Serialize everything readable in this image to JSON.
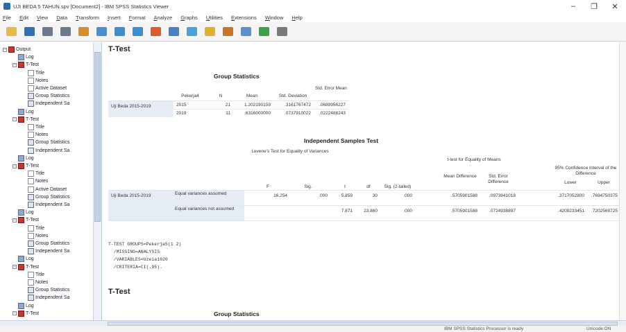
{
  "window": {
    "title": "UJI BEDA 5 TAHUN.spv [Document2] - IBM SPSS Statistics Viewer",
    "minimize": "–",
    "maximize": "❐",
    "close": "✕"
  },
  "menu": [
    "File",
    "Edit",
    "View",
    "Data",
    "Transform",
    "Insert",
    "Format",
    "Analyze",
    "Graphs",
    "Utilities",
    "Extensions",
    "Window",
    "Help"
  ],
  "toolbar_icons": [
    "open-icon",
    "save-icon",
    "print-icon",
    "print-preview-icon",
    "export-icon",
    "goto-data-icon",
    "undo-icon",
    "redo-icon",
    "goto-case-icon",
    "goto-variable-icon",
    "variables-icon",
    "insert-output-icon",
    "designate-window-icon",
    "spelling-icon",
    "show-all-icon",
    "collapse-icon"
  ],
  "nav": {
    "items": [
      {
        "label": "Output",
        "icon": "book",
        "level": 0
      },
      {
        "label": "Log",
        "icon": "log",
        "level": 1
      },
      {
        "label": "T-Test",
        "icon": "book",
        "level": 1
      },
      {
        "label": "Title",
        "icon": "page",
        "level": 2
      },
      {
        "label": "Notes",
        "icon": "page",
        "level": 2
      },
      {
        "label": "Active Dataset",
        "icon": "page",
        "level": 2
      },
      {
        "label": "Group Statistics",
        "icon": "tbl",
        "level": 2
      },
      {
        "label": "Independent Sa",
        "icon": "tbl",
        "level": 2
      },
      {
        "label": "Log",
        "icon": "log",
        "level": 1
      },
      {
        "label": "T-Test",
        "icon": "book",
        "level": 1
      },
      {
        "label": "Title",
        "icon": "page",
        "level": 2
      },
      {
        "label": "Notes",
        "icon": "page",
        "level": 2
      },
      {
        "label": "Group Statistics",
        "icon": "tbl",
        "level": 2
      },
      {
        "label": "Independent Sa",
        "icon": "tbl",
        "level": 2
      },
      {
        "label": "Log",
        "icon": "log",
        "level": 1
      },
      {
        "label": "T-Test",
        "icon": "book",
        "level": 1
      },
      {
        "label": "Title",
        "icon": "page",
        "level": 2
      },
      {
        "label": "Notes",
        "icon": "page",
        "level": 2
      },
      {
        "label": "Active Dataset",
        "icon": "page",
        "level": 2
      },
      {
        "label": "Group Statistics",
        "icon": "tbl",
        "level": 2
      },
      {
        "label": "Independent Sa",
        "icon": "tbl",
        "level": 2
      },
      {
        "label": "Log",
        "icon": "log",
        "level": 1
      },
      {
        "label": "T-Test",
        "icon": "book",
        "level": 1
      },
      {
        "label": "Title",
        "icon": "page",
        "level": 2
      },
      {
        "label": "Notes",
        "icon": "page",
        "level": 2
      },
      {
        "label": "Group Statistics",
        "icon": "tbl",
        "level": 2
      },
      {
        "label": "Independent Sa",
        "icon": "tbl",
        "level": 2
      },
      {
        "label": "Log",
        "icon": "log",
        "level": 1
      },
      {
        "label": "T-Test",
        "icon": "book",
        "level": 1
      },
      {
        "label": "Title",
        "icon": "page",
        "level": 2
      },
      {
        "label": "Notes",
        "icon": "page",
        "level": 2
      },
      {
        "label": "Group Statistics",
        "icon": "tbl",
        "level": 2
      },
      {
        "label": "Independent Sa",
        "icon": "tbl",
        "level": 2
      },
      {
        "label": "Log",
        "icon": "log",
        "level": 1
      },
      {
        "label": "T-Test",
        "icon": "book",
        "level": 1
      }
    ]
  },
  "content": {
    "heading1": "T-Test",
    "group_stats": {
      "title": "Group Statistics",
      "headers": [
        "Pekerja4",
        "N",
        "Mean",
        "Std. Deviation",
        "Std. Error Mean"
      ],
      "row_label": "Uji Beda 2015-2019",
      "rows": [
        [
          "2015",
          "21",
          "1.202190159",
          ".3161767472",
          ".0689956227"
        ],
        [
          "2019",
          "11",
          ".6316000000",
          ".0737910022",
          ".0222488243"
        ]
      ]
    },
    "indep_test": {
      "title": "Independent Samples Test",
      "levene_header": "Levene's Test for Equality of Variances",
      "ttest_header": "t-test for Equality of Means",
      "ci_header": "95% Confidence Interval of the Difference",
      "columns": [
        "F",
        "Sig.",
        "t",
        "df",
        "Sig. (2-tailed)",
        "Mean Difference",
        "Std. Error Difference",
        "Lower",
        "Upper"
      ],
      "row_label": "Uji Beda 2015-2019",
      "rows": [
        {
          "label": "Equal variances assumed",
          "values": [
            "16.254",
            ".000",
            "5.859",
            "30",
            ".000",
            ".5705901588",
            ".0973841018",
            ".3717052800",
            ".7694750375"
          ]
        },
        {
          "label": "Equal variances not assumed",
          "values": [
            "",
            "",
            "7.871",
            "23.860",
            ".000",
            ".5705901588",
            ".0724938897",
            ".4209233451",
            ".7202569725"
          ]
        }
      ]
    },
    "syntax": [
      "T-TEST GROUPS=Pekerja5(1 2)",
      "  /MISSING=ANALYSIS",
      "  /VARIABLES=Uzeia1620",
      "  /CRITERIA=CI(.95)."
    ],
    "heading2": "T-Test",
    "group_stats2_title": "Group Statistics"
  },
  "status": {
    "processor": "IBM SPSS Statistics Processor is ready",
    "unicode": "Unicode:ON"
  }
}
